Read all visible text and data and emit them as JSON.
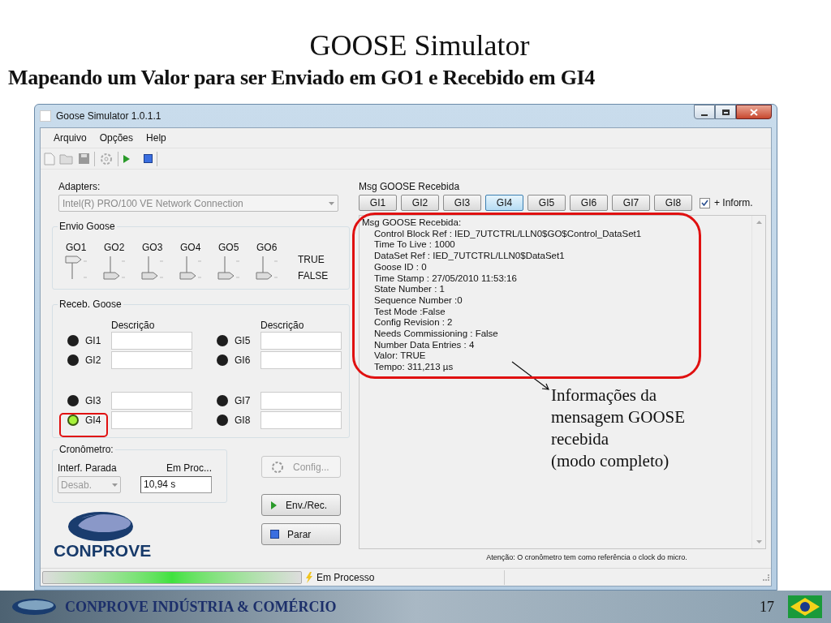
{
  "slide": {
    "title": "GOOSE Simulator",
    "subtitle": "Mapeando um Valor para ser Enviado em GO1 e Recebido em GI4"
  },
  "window": {
    "title": "Goose Simulator 1.0.1.1",
    "menu": [
      "Arquivo",
      "Opções",
      "Help"
    ]
  },
  "adapters": {
    "label": "Adapters:",
    "value": "Intel(R) PRO/100 VE Network Connection",
    "disabled": true
  },
  "envio": {
    "title": "Envio Goose",
    "true_label": "TRUE",
    "false_label": "FALSE",
    "switches": [
      {
        "label": "GO1",
        "on": true
      },
      {
        "label": "GO2",
        "on": false
      },
      {
        "label": "GO3",
        "on": false
      },
      {
        "label": "GO4",
        "on": false
      },
      {
        "label": "GO5",
        "on": false
      },
      {
        "label": "GO6",
        "on": false
      }
    ]
  },
  "receb": {
    "title": "Receb. Goose",
    "headers": [
      "Descrição",
      "Descrição"
    ],
    "inputs": [
      {
        "label": "GI1",
        "on": false
      },
      {
        "label": "GI2",
        "on": false
      },
      {
        "label": "GI3",
        "on": false
      },
      {
        "label": "GI4",
        "on": true
      },
      {
        "label": "GI5",
        "on": false
      },
      {
        "label": "GI6",
        "on": false
      },
      {
        "label": "GI7",
        "on": false
      },
      {
        "label": "GI8",
        "on": false
      }
    ]
  },
  "cronometro": {
    "title": "Cronômetro:",
    "interf_label": "Interf. Parada",
    "interf_value": "Desab.",
    "interf_disabled": true,
    "proc_label": "Em Proc...",
    "proc_value": "10,94 s"
  },
  "buttons": [
    {
      "label": "Config...",
      "kind": "config",
      "disabled": true
    },
    {
      "label": "Env./Rec.",
      "kind": "play",
      "disabled": false
    },
    {
      "label": "Parar",
      "kind": "stop",
      "disabled": false
    }
  ],
  "logo_text": "CONPROVE",
  "msg": {
    "title": "Msg GOOSE Recebida",
    "more_info": {
      "label": "+ Inform.",
      "checked": true
    },
    "tabs": [
      {
        "label": "GI1",
        "selected": false
      },
      {
        "label": "GI2",
        "selected": false
      },
      {
        "label": "GI3",
        "selected": false
      },
      {
        "label": "GI4",
        "selected": true
      },
      {
        "label": "GI5",
        "selected": false
      },
      {
        "label": "GI6",
        "selected": false
      },
      {
        "label": "GI7",
        "selected": false
      },
      {
        "label": "GI8",
        "selected": false
      }
    ],
    "header": "Msg GOOSE Recebida:",
    "lines": [
      "Control Block Ref : IED_7UTCTRL/LLN0$GO$Control_DataSet1",
      "Time To Live : 1000",
      "DataSet Ref : IED_7UTCTRL/LLN0$DataSet1",
      "Goose ID : 0",
      "Time Stamp : 27/05/2010 11:53:16",
      "State Number : 1",
      "Sequence Number :0",
      "Test Mode :False",
      "Config Revision : 2",
      "Needs Commissioning : False",
      "Number Data Entries : 4",
      "Valor: TRUE",
      "Tempo: 311,213 µs"
    ],
    "note": "Atenção: O cronômetro tem como referência o clock do micro."
  },
  "status": {
    "text": "Em Processo"
  },
  "annotation": [
    "Informações da",
    "mensagem GOOSE",
    "recebida",
    "(modo completo)"
  ],
  "footer": {
    "company": "CONPROVE INDÚSTRIA & COMÉRCIO",
    "page": "17"
  }
}
